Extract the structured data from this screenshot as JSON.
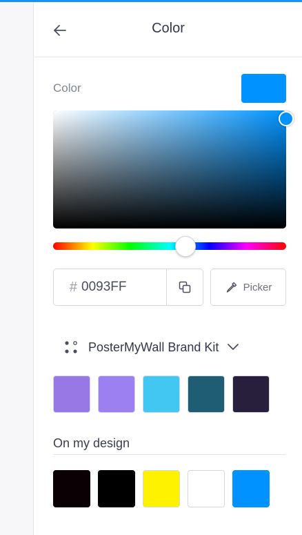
{
  "header": {
    "title": "Color"
  },
  "color": {
    "label": "Color",
    "current_hex_color": "#0093FF",
    "hue_color": "#0093FF",
    "hex_value": "0093FF",
    "hash_symbol": "#",
    "hue_degrees": 205
  },
  "picker": {
    "label": "Picker"
  },
  "brand_kit": {
    "label": "PosterMyWall Brand Kit",
    "swatches": [
      "#9878e5",
      "#9c80f2",
      "#42c7f2",
      "#1f5d74",
      "#271f3c"
    ]
  },
  "design_colors": {
    "title": "On my design",
    "swatches": [
      "#0b0003",
      "#000000",
      "#fff200",
      "#ffffff",
      "#0093ff"
    ]
  },
  "icons": {
    "back": "arrow-left-icon",
    "copy": "copy-icon",
    "picker": "eyedropper-icon",
    "brand_kit": "dots-icon",
    "chevron": "chevron-down-icon"
  }
}
